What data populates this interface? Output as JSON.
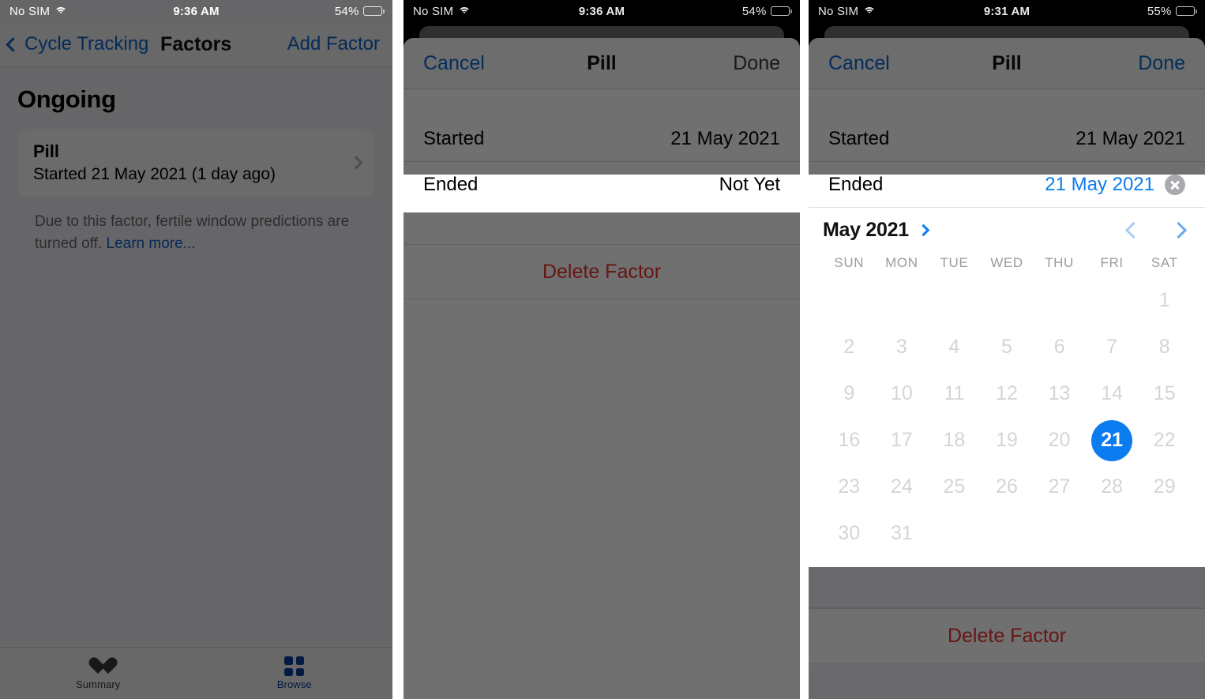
{
  "colors": {
    "ios_blue": "#0a7cf0",
    "link_blue": "#0a66d0",
    "destructive_red": "#e8342d",
    "selected_day_bg": "#0a7cf0",
    "sheet_bg": "#ffffff",
    "list_bg": "#f2f2f7"
  },
  "panel1": {
    "status": {
      "carrier": "No SIM",
      "wifi_icon": "wifi-icon",
      "time": "9:36 AM",
      "battery_percent": "54%",
      "battery_icon": "battery-icon"
    },
    "nav": {
      "back_icon": "chevron-left-icon",
      "back_label": "Cycle Tracking",
      "title": "Factors",
      "action": "Add Factor"
    },
    "section_title": "Ongoing",
    "card": {
      "title": "Pill",
      "subtitle": "Started 21 May 2021 (1 day ago)",
      "disclosure_icon": "chevron-right-icon"
    },
    "footnote": {
      "text": "Due to this factor, fertile window predictions are turned off. ",
      "link": "Learn more..."
    },
    "tabs": [
      {
        "label": "Summary",
        "icon": "heart-icon",
        "active": false
      },
      {
        "label": "Browse",
        "icon": "grid-icon",
        "active": true
      }
    ]
  },
  "panel2": {
    "status": {
      "carrier": "No SIM",
      "wifi_icon": "wifi-icon",
      "time": "9:36 AM",
      "battery_percent": "54%",
      "battery_icon": "battery-icon"
    },
    "sheet_nav": {
      "cancel": "Cancel",
      "title": "Pill",
      "done": "Done",
      "done_enabled": false
    },
    "rows": [
      {
        "label": "Started",
        "value": "21 May 2021",
        "highlighted": false
      },
      {
        "label": "Ended",
        "value": "Not Yet",
        "highlighted": true
      }
    ],
    "delete_label": "Delete Factor"
  },
  "panel3": {
    "status": {
      "carrier": "No SIM",
      "wifi_icon": "wifi-icon",
      "time": "9:31 AM",
      "battery_percent": "55%",
      "battery_icon": "battery-icon"
    },
    "sheet_nav": {
      "cancel": "Cancel",
      "title": "Pill",
      "done": "Done",
      "done_enabled": true
    },
    "rows": [
      {
        "label": "Started",
        "value": "21 May 2021"
      },
      {
        "label": "Ended",
        "value": "21 May 2021",
        "clear_icon": "clear-circle-icon"
      }
    ],
    "calendar": {
      "month_label": "May 2021",
      "month_chevron_icon": "chevron-right-icon",
      "prev_icon": "chevron-left-icon",
      "next_icon": "chevron-right-icon",
      "dow": [
        "SUN",
        "MON",
        "TUE",
        "WED",
        "THU",
        "FRI",
        "SAT"
      ],
      "selected_day": 21,
      "weeks": [
        [
          "",
          "",
          "",
          "",
          "",
          "",
          "1"
        ],
        [
          "2",
          "3",
          "4",
          "5",
          "6",
          "7",
          "8"
        ],
        [
          "9",
          "10",
          "11",
          "12",
          "13",
          "14",
          "15"
        ],
        [
          "16",
          "17",
          "18",
          "19",
          "20",
          "21",
          "22"
        ],
        [
          "23",
          "24",
          "25",
          "26",
          "27",
          "28",
          "29"
        ],
        [
          "30",
          "31",
          "",
          "",
          "",
          "",
          ""
        ]
      ]
    },
    "delete_label": "Delete Factor"
  }
}
